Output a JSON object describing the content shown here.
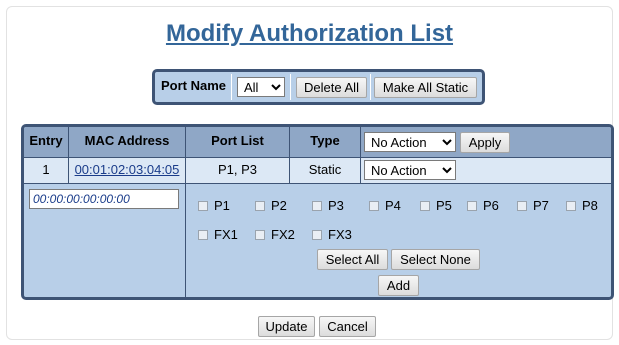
{
  "page": {
    "title": "Modify Authorization List"
  },
  "port_filter": {
    "label": "Port Name",
    "selected": "All",
    "delete_all_label": "Delete All",
    "make_all_static_label": "Make All Static"
  },
  "table": {
    "headers": {
      "entry": "Entry",
      "mac": "MAC Address",
      "port_list": "Port List",
      "type": "Type"
    },
    "bulk_action": {
      "selected": "No Action",
      "apply_label": "Apply"
    },
    "rows": [
      {
        "entry": "1",
        "mac": "00:01:02:03:04:05",
        "ports": "P1, P3",
        "type": "Static",
        "action": "No Action"
      }
    ],
    "new_entry": {
      "mac_value": "00:00:00:00:00:00",
      "ports": [
        "P1",
        "P2",
        "P3",
        "P4",
        "P5",
        "P6",
        "P7",
        "P8",
        "FX1",
        "FX2",
        "FX3"
      ],
      "select_all_label": "Select All",
      "select_none_label": "Select None",
      "add_label": "Add"
    }
  },
  "footer": {
    "update_label": "Update",
    "cancel_label": "Cancel"
  },
  "colors": {
    "panel_bg": "#b8cfe8",
    "header_bg": "#8fa7c6",
    "row_bg": "#dce8f5",
    "border": "#3e5475",
    "title": "#336699"
  }
}
